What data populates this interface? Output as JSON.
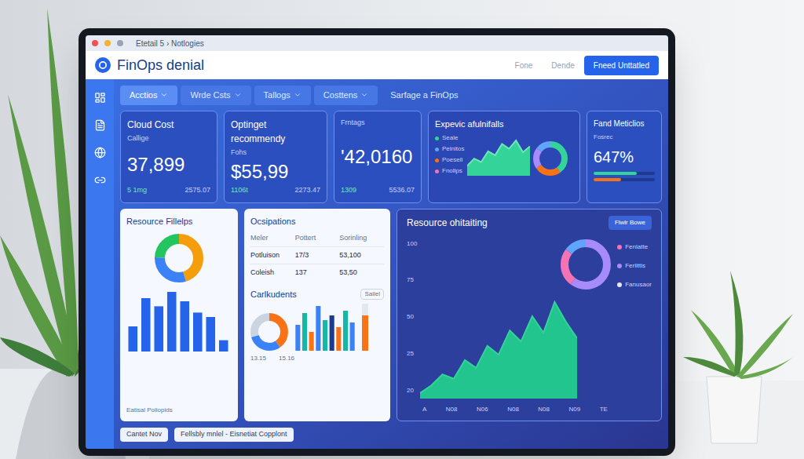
{
  "browser": {
    "title": "Etetail 5 › Notlogies",
    "dots": [
      {
        "color": "#ef5350"
      },
      {
        "color": "#f5b335"
      },
      {
        "color": "#9aa5b8"
      }
    ]
  },
  "header": {
    "logo": "FinOps denial",
    "links": [
      "Fone",
      "Dende"
    ],
    "button": "Fneed Unttatled"
  },
  "tabs": [
    {
      "label": "Acctios",
      "selected": true
    },
    {
      "label": "Wrde Csts",
      "selected": false
    },
    {
      "label": "Tallogs",
      "selected": false
    },
    {
      "label": "Costtens",
      "selected": false
    }
  ],
  "tab_link": "Sarfage a FinOps",
  "kpis": [
    {
      "title": "Cloud Cost",
      "subtitle": "Callige",
      "value": "37,899",
      "foot_left": "5 1mg",
      "foot_right": "2575.07"
    },
    {
      "title": "Optinget recommendy",
      "subtitle": "Fohs",
      "value": "$55,99",
      "foot_left": "1106t",
      "foot_right": "2273.47"
    },
    {
      "title": "Frntags",
      "value": "'42,0160",
      "foot_left": "1309",
      "foot_right": "5536.07"
    }
  ],
  "expense": {
    "title": "Expevic afulnifalls",
    "legend": [
      {
        "label": "Seale",
        "color": "#34d399"
      },
      {
        "label": "Pelnitos",
        "color": "#60a5fa"
      },
      {
        "label": "Poesell",
        "color": "#f97316"
      },
      {
        "label": "Fnollps",
        "color": "#f472b6"
      }
    ],
    "series": [
      20,
      35,
      28,
      50,
      42,
      65,
      55,
      72,
      48,
      60
    ],
    "donut": [
      {
        "value": 40,
        "color": "#34d399"
      },
      {
        "value": 25,
        "color": "#f97316"
      },
      {
        "value": 20,
        "color": "#a78bfa"
      },
      {
        "value": 15,
        "color": "#60a5fa"
      }
    ]
  },
  "meter": {
    "title": "Fand Meticlios",
    "subtitle": "Fosrec",
    "value": "647%",
    "bars": [
      {
        "level": 0.7,
        "color": "#34d399"
      },
      {
        "level": 0.45,
        "color": "#f97316"
      }
    ]
  },
  "fillups": {
    "title": "Resource Fillelps",
    "donut": [
      {
        "value": 45,
        "color": "#f59e0b"
      },
      {
        "value": 30,
        "color": "#3b82f6"
      },
      {
        "value": 25,
        "color": "#22c55e"
      }
    ],
    "bars": [
      40,
      85,
      72,
      95,
      80,
      62,
      55,
      18
    ],
    "footer": "Eatisal Poliopids"
  },
  "table": {
    "title": "Ocsipations",
    "columns": [
      "Meler",
      "Pottert",
      "Sorinling"
    ],
    "rows": [
      [
        "Potluison",
        "17/3",
        "53,100"
      ],
      [
        "Coleish",
        "137",
        "53,50"
      ]
    ]
  },
  "components": {
    "title": "Carlkudents",
    "tag": "Sailel",
    "donut": [
      {
        "value": 40,
        "color": "#f97316"
      },
      {
        "value": 30,
        "color": "#3b82f6"
      },
      {
        "value": 30,
        "color": "#cbd5e1"
      }
    ],
    "bars": [
      {
        "value": 55,
        "color": "#3b82f6"
      },
      {
        "value": 80,
        "color": "#14b8a6"
      },
      {
        "value": 40,
        "color": "#f97316"
      },
      {
        "value": 95,
        "color": "#3b82f6"
      },
      {
        "value": 65,
        "color": "#14b8a6"
      },
      {
        "value": 75,
        "color": "#1e3a8a"
      },
      {
        "value": 50,
        "color": "#f97316"
      },
      {
        "value": 85,
        "color": "#14b8a6"
      },
      {
        "value": 60,
        "color": "#3b82f6"
      }
    ],
    "gauge": 0.75,
    "ticks": [
      "13.15",
      "15.16"
    ]
  },
  "resource": {
    "title": "Resource ohitaiting",
    "button": "Flwlr Bowe",
    "y_ticks": [
      "100",
      "75",
      "50",
      "25",
      "20"
    ],
    "x_ticks": [
      "A",
      "N08",
      "N06",
      "N08",
      "N08",
      "N09",
      "TE"
    ],
    "series": [
      5,
      12,
      22,
      18,
      35,
      28,
      48,
      40,
      62,
      52,
      75,
      60,
      88,
      70,
      55
    ],
    "donut": [
      {
        "value": 60,
        "color": "#a78bfa"
      },
      {
        "value": 25,
        "color": "#f472b6"
      },
      {
        "value": 15,
        "color": "#60a5fa"
      }
    ],
    "legend": [
      {
        "label": "Fenlatte",
        "color": "#f472b6"
      },
      {
        "label": "Ferlittis",
        "color": "#a78bfa"
      },
      {
        "label": "Fanusaor",
        "color": "#e5e7eb"
      }
    ]
  },
  "footer": [
    "Cantet Nov",
    "Fellsbly mnlel - Eisnetiat Copplont"
  ]
}
